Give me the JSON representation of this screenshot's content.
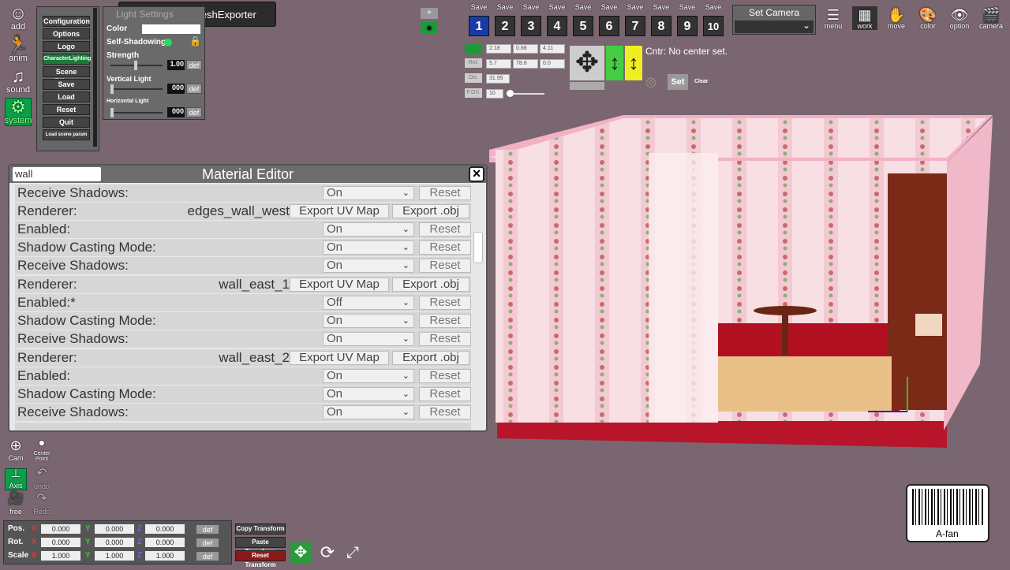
{
  "tooltip": "Show Grey.MeshExporter",
  "left_toolbar": [
    {
      "label": "add",
      "icon": "person-add-icon"
    },
    {
      "label": "anim",
      "icon": "running-person-icon"
    },
    {
      "label": "sound",
      "icon": "music-note-icon"
    },
    {
      "label": "system",
      "icon": "gears-icon"
    }
  ],
  "system_menu": [
    "Configuration",
    "Options",
    "Logo",
    "CharacterLighting",
    "Scene Effects",
    "Save",
    "Load",
    "Reset",
    "Quit",
    "Load scene param"
  ],
  "light_panel": {
    "title": "Light Settings",
    "color_label": "Color",
    "self_shadowing_label": "Self-Shadowing",
    "strength_label": "Strength",
    "strength_value": "1.00",
    "vertical_label": "Vertical Light",
    "vertical_value": "000",
    "horizontal_label": "Horizontal Light",
    "horizontal_value": "000",
    "def_label": "def"
  },
  "save_slots": {
    "save_label": "Save",
    "slots": [
      "1",
      "2",
      "3",
      "4",
      "5",
      "6",
      "7",
      "8",
      "9",
      "10"
    ],
    "set_camera": "Set Camera"
  },
  "top_right_icons": [
    "menu",
    "work",
    "move",
    "color",
    "option",
    "camera"
  ],
  "camera_panel": {
    "pos": [
      "2.18",
      "0.88",
      "4.11"
    ],
    "rot": [
      "5.7",
      "78.8",
      "0.0"
    ],
    "dis": "31.95",
    "fov": "10",
    "labels": [
      "Pos.",
      "Rot.",
      "Dis.",
      "F.OV."
    ],
    "center_text": "Cntr: No center set.",
    "set_label": "Set",
    "clear_label": "Clear"
  },
  "material_editor": {
    "title": "Material Editor",
    "search": "wall",
    "rows": [
      {
        "kind": "prop",
        "label": "Receive Shadows:",
        "value": "On",
        "reset": "Reset"
      },
      {
        "kind": "renderer",
        "label": "Renderer:",
        "name": "edges_wall_west",
        "uv": "Export UV Map",
        "obj": "Export .obj"
      },
      {
        "kind": "prop",
        "label": "Enabled:",
        "value": "On",
        "reset": "Reset"
      },
      {
        "kind": "prop",
        "label": "Shadow Casting Mode:",
        "value": "On",
        "reset": "Reset"
      },
      {
        "kind": "prop",
        "label": "Receive Shadows:",
        "value": "On",
        "reset": "Reset"
      },
      {
        "kind": "renderer",
        "label": "Renderer:",
        "name": "wall_east_1",
        "uv": "Export UV Map",
        "obj": "Export .obj"
      },
      {
        "kind": "prop",
        "label": "Enabled:*",
        "value": "Off",
        "reset": "Reset"
      },
      {
        "kind": "prop",
        "label": "Shadow Casting Mode:",
        "value": "On",
        "reset": "Reset"
      },
      {
        "kind": "prop",
        "label": "Receive Shadows:",
        "value": "On",
        "reset": "Reset"
      },
      {
        "kind": "renderer",
        "label": "Renderer:",
        "name": "wall_east_2",
        "uv": "Export UV Map",
        "obj": "Export .obj"
      },
      {
        "kind": "prop",
        "label": "Enabled:",
        "value": "On",
        "reset": "Reset"
      },
      {
        "kind": "prop",
        "label": "Shadow Casting Mode:",
        "value": "On",
        "reset": "Reset"
      },
      {
        "kind": "prop",
        "label": "Receive Shadows:",
        "value": "On",
        "reset": "Reset"
      }
    ]
  },
  "bottom_left_tools": [
    {
      "label": "Cam",
      "icon": "cam-plus-icon"
    },
    {
      "label": "Center Point",
      "icon": "center-point-icon"
    },
    {
      "label": "Axis",
      "icon": "axis-icon"
    },
    {
      "label": "undo",
      "icon": "undo-icon"
    },
    {
      "label": "free",
      "icon": "film-camera-icon"
    },
    {
      "label": "Redo",
      "icon": "redo-icon"
    }
  ],
  "transform": {
    "rows": [
      {
        "label": "Pos.",
        "x": "0.000",
        "y": "0.000",
        "z": "0.000"
      },
      {
        "label": "Rot.",
        "x": "0.000",
        "y": "0.000",
        "z": "0.000"
      },
      {
        "label": "Scale",
        "x": "1.000",
        "y": "1.000",
        "z": "1.000"
      }
    ],
    "x": "X",
    "y": "Y",
    "z": "Z",
    "def_label": "def",
    "copy": "Copy Transform",
    "paste": "Paste Transform",
    "reset": "Reset Transform"
  },
  "logo_text": "A-fan",
  "colors": {
    "background": "#7a6670",
    "system_green": "#0aa04a",
    "wall_pink": "#f6d6de",
    "floor_red": "#c0182a"
  }
}
